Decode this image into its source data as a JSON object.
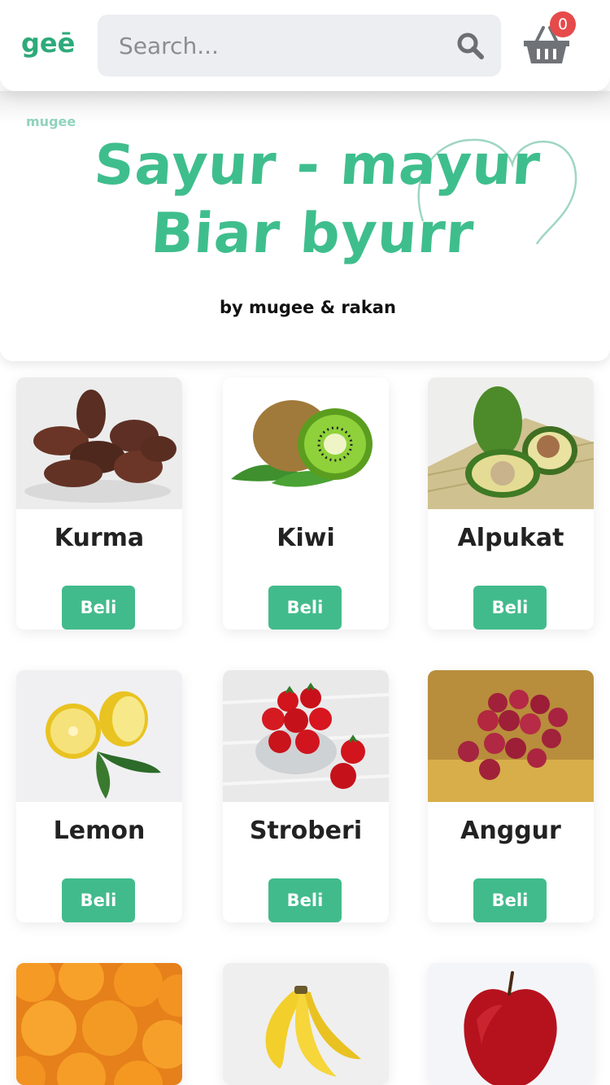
{
  "header": {
    "logo_text": "geē",
    "search_placeholder": "Search...",
    "cart_count": "0"
  },
  "banner": {
    "brand": "mugee",
    "line1": "Sayur - mayur",
    "line2": "Biar byurr",
    "byline": "by mugee & rakan"
  },
  "colors": {
    "accent": "#42bb8c",
    "badge": "#e64a4a",
    "search_bg": "#eceef1"
  },
  "products": [
    {
      "name": "Kurma",
      "button": "Beli",
      "image": "dates-image"
    },
    {
      "name": "Kiwi",
      "button": "Beli",
      "image": "kiwi-image"
    },
    {
      "name": "Alpukat",
      "button": "Beli",
      "image": "avocado-image"
    },
    {
      "name": "Lemon",
      "button": "Beli",
      "image": "lemon-image"
    },
    {
      "name": "Stroberi",
      "button": "Beli",
      "image": "strawberry-image"
    },
    {
      "name": "Anggur",
      "button": "Beli",
      "image": "grape-image"
    },
    {
      "image": "orange-image"
    },
    {
      "image": "banana-image"
    },
    {
      "image": "apple-image"
    }
  ]
}
